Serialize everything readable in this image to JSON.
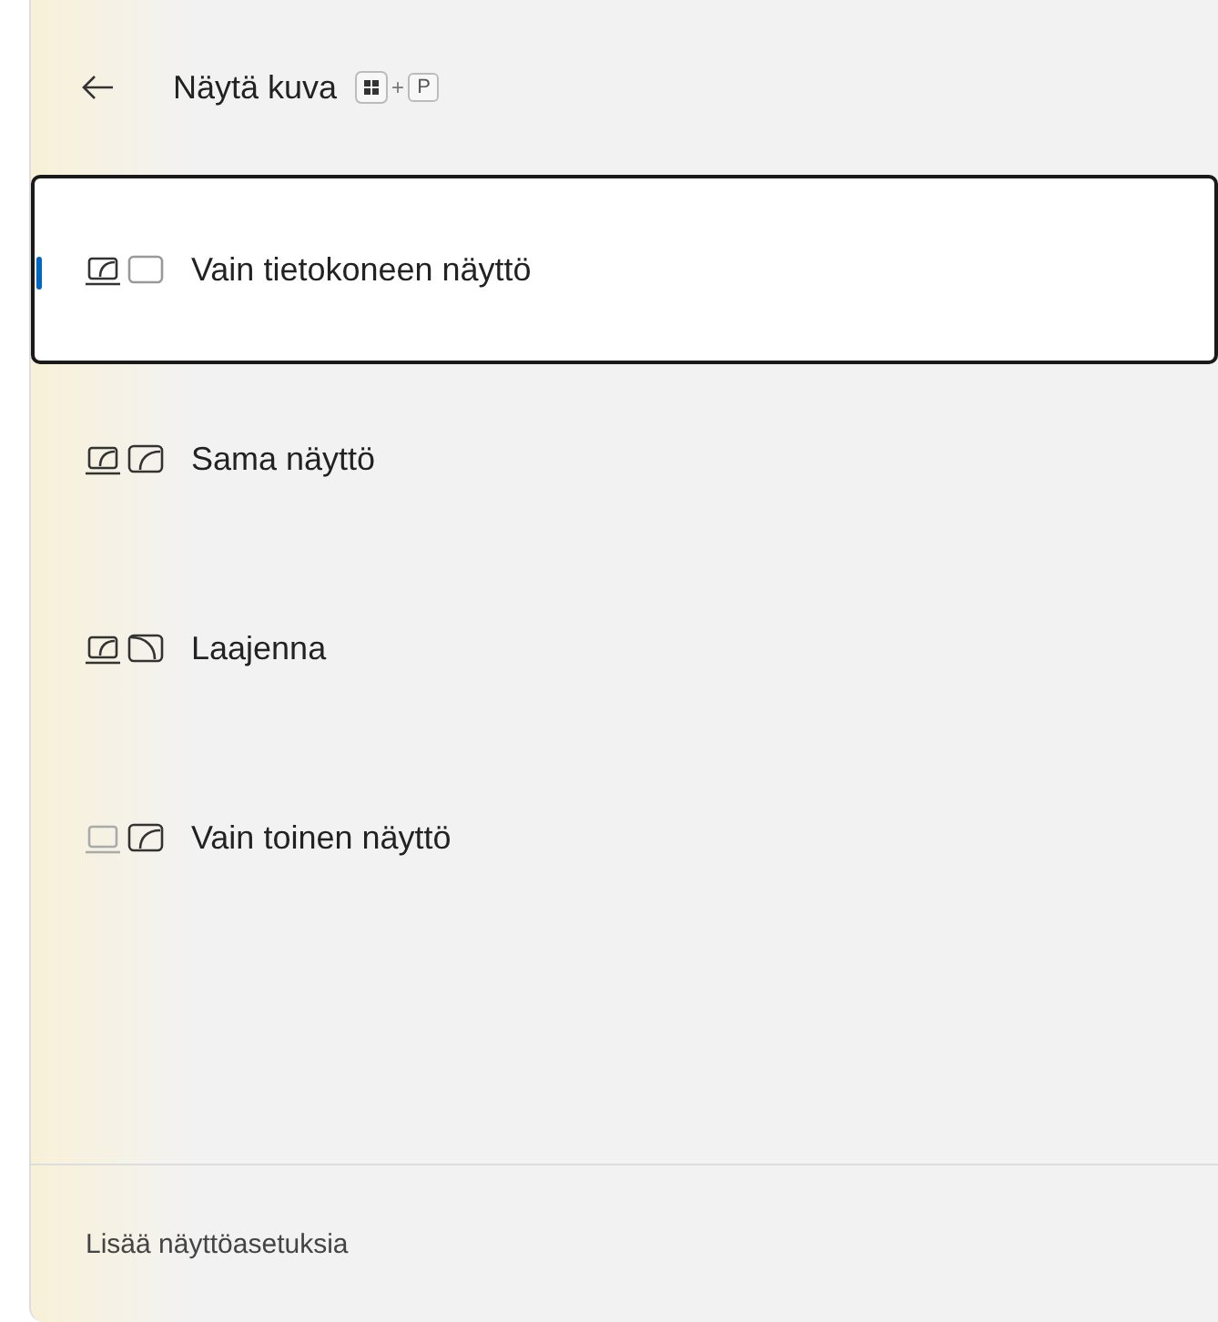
{
  "header": {
    "title": "Näytä kuva",
    "shortcut_plus": "+",
    "shortcut_key": "P"
  },
  "options": [
    {
      "label": "Vain tietokoneen näyttö",
      "kind": "pc_only",
      "selected": true
    },
    {
      "label": "Sama näyttö",
      "kind": "duplicate",
      "selected": false
    },
    {
      "label": "Laajenna",
      "kind": "extend",
      "selected": false
    },
    {
      "label": "Vain toinen näyttö",
      "kind": "second_only",
      "selected": false
    }
  ],
  "footer": {
    "link": "Lisää näyttöasetuksia"
  }
}
